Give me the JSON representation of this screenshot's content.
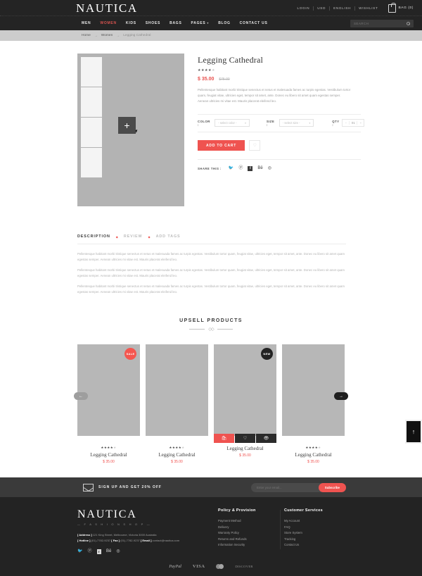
{
  "topbar": {
    "brand": "NAUTICA",
    "links": [
      "LOGIN",
      "USD",
      "ENGLISH",
      "WISHLIST"
    ],
    "bag_label": "BAG (0)",
    "bag_icon": "shopping-bag-icon"
  },
  "nav": {
    "items": [
      {
        "label": "MEN",
        "active": false,
        "caret": false
      },
      {
        "label": "WOMEN",
        "active": true,
        "caret": false
      },
      {
        "label": "KIDS",
        "active": false,
        "caret": false
      },
      {
        "label": "SHOES",
        "active": false,
        "caret": false
      },
      {
        "label": "BAGS",
        "active": false,
        "caret": false
      },
      {
        "label": "PAGES",
        "active": false,
        "caret": true
      },
      {
        "label": "BLOG",
        "active": false,
        "caret": false
      },
      {
        "label": "CONTACT US",
        "active": false,
        "caret": false
      }
    ],
    "search_placeholder": "SEARCH",
    "search_value": "",
    "search_icon": "search-icon"
  },
  "breadcrumb": {
    "home": "Home",
    "sep": "→",
    "category": "Women",
    "current": "Legging Cathedral"
  },
  "product": {
    "title": "Legging Cathedral",
    "rating_filled": 4,
    "rating_total": 5,
    "price": "$ 35.00",
    "price_old": "$75.00",
    "description": "Pellentesque habitant morbi tristique senectus et netus et malesuada fames ac turpis egestas. Vestibulum tortor quam, feugiat vitae, ultricies eget, tempor sit amet, ante. Donec eu libero sit amet quam egestas semper. Aenean ultricies mi vitae est. Mauris placerat eleifend leo.",
    "zoom_icon": "plus-zoom-icon",
    "options": {
      "color_label": "COLOR :",
      "color_value": "- select color -",
      "size_label": "SIZE :",
      "size_value": "- select size -",
      "qty_label": "QTY :",
      "qty_value": "01",
      "qty_minus": "−",
      "qty_plus": "+"
    },
    "add_to_cart": "ADD TO CART",
    "wishlist_icon": "heart-icon",
    "share_label": "SHARE THIS :",
    "share_icons": [
      "twitter-icon",
      "pinterest-icon",
      "facebook-icon",
      "behance-icon",
      "dribbble-icon"
    ]
  },
  "tabs": {
    "items": [
      {
        "label": "DESCRIPTION",
        "active": true
      },
      {
        "label": "REVIEW",
        "active": false
      },
      {
        "label": "ADD TAGS",
        "active": false
      }
    ],
    "paragraphs": [
      "Pellentesque habitant morbi tristique senectus et netus et malesuada fames ac turpis egestas. Vestibulum tortor quam, feugiat vitae, ultricies eget, tempor sit amet, ante. Donec eu libero sit amet quam egestas semper. Aenean ultricies mi vitae est. Mauris placerat eleifend leo.",
      "Pellentesque habitant morbi tristique senectus et netus et malesuada fames ac turpis egestas. Vestibulum tortor quam, feugiat vitae, ultricies eget, tempor sit amet, ante. Donec eu libero sit amet quam egestas semper. Aenean ultricies mi vitae est. Mauris placerat eleifend leo.",
      "Pellentesque habitant morbi tristique senectus et netus et malesuada fames ac turpis egestas. Vestibulum tortor quam, feugiat vitae, ultricies eget, tempor sit amet, ante. Donec eu libero sit amet quam egestas semper. Aenean ultricies mi vitae est. Mauris placerat eleifend leo."
    ]
  },
  "upsell": {
    "title": "UPSELL PRODUCTS",
    "prev_arrow": "←",
    "next_arrow": "→",
    "products": [
      {
        "name": "Legging Cathedral",
        "price": "$ 35.00",
        "badge": "SALE",
        "badge_type": "sale",
        "stars": 4,
        "hovered": false
      },
      {
        "name": "Legging Cathedral",
        "price": "$ 35.00",
        "badge": "",
        "badge_type": "",
        "stars": 4,
        "hovered": false
      },
      {
        "name": "Legging Cathedral",
        "price": "$ 35.00",
        "badge": "NEW",
        "badge_type": "new",
        "stars": 4,
        "hovered": true
      },
      {
        "name": "Legging Cathedral",
        "price": "$ 35.00",
        "badge": "",
        "badge_type": "",
        "stars": 4,
        "hovered": false
      }
    ],
    "hover_actions": [
      "cart-icon",
      "heart-icon",
      "eye-icon"
    ]
  },
  "newsletter": {
    "envelope_icon": "envelope-icon",
    "text": "SIGN UP AND GET 20% OFF",
    "placeholder": "Enter your email...",
    "value": "",
    "button": "Subscribe"
  },
  "footer": {
    "logo": "NAUTICA",
    "tagline": "— F A S H I O N   S H O P —",
    "address_key": "[ Address ]",
    "address_value": "121 King Street, Melbourne, Victoria 3000 Australia",
    "hotline_key": "[ Hotline ]",
    "hotline_value": "(01)-7782-9237",
    "fax_key": "[ Fax ]",
    "fax_value": "(01)-7782-9237",
    "email_key": "[ Email ]",
    "email_value": "contact@nautica.com",
    "social_icons": [
      "twitter-icon",
      "pinterest-icon",
      "facebook-icon",
      "behance-icon",
      "dribbble-icon"
    ],
    "columns": [
      {
        "title": "Policy & Provision",
        "items": [
          "Payment Method",
          "Delivery",
          "Warranty Policy",
          "Returns and Refunds",
          "Information Security"
        ]
      },
      {
        "title": "Customer Services",
        "items": [
          "My Account",
          "FAQ",
          "Store System",
          "Tracking",
          "Contact Us"
        ]
      }
    ],
    "payments": [
      "PayPal",
      "VISA",
      "mastercard-icon",
      "DISCOVER"
    ]
  },
  "scroll_top": {
    "icon": "arrow-up-icon",
    "glyph": "↑"
  },
  "colors": {
    "accent": "#ef5350",
    "dark": "#242424",
    "footer": "#232323"
  }
}
